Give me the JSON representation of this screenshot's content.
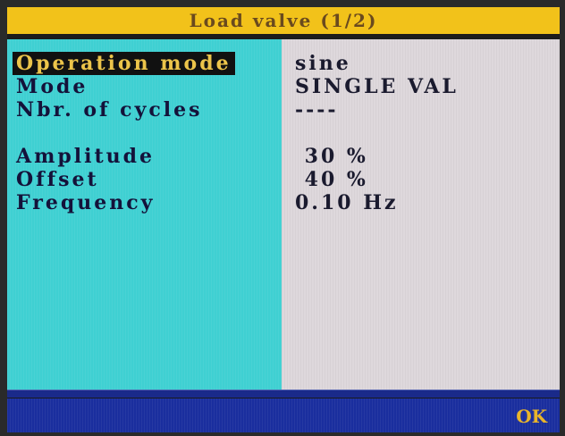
{
  "title": "Load valve (1/2)",
  "parameters": [
    {
      "label": "Operation mode",
      "value": "sine",
      "selected": true
    },
    {
      "label": "Mode",
      "value": "SINGLE VAL",
      "selected": false
    },
    {
      "label": "Nbr. of cycles",
      "value": "----",
      "selected": false
    },
    {
      "label": "Amplitude",
      "value": " 30 %",
      "selected": false
    },
    {
      "label": "Offset",
      "value": " 40 %",
      "selected": false
    },
    {
      "label": "Frequency",
      "value": "0.10 Hz",
      "selected": false
    }
  ],
  "softkeys": {
    "ok_label": "OK"
  },
  "colors": {
    "title_bar": "#f2c21a",
    "left_panel": "#3fd0d2",
    "right_panel": "#ded8dc",
    "bottom_bar": "#1a2e9e",
    "selection_bg": "#111111",
    "selection_fg": "#ecc44a"
  }
}
